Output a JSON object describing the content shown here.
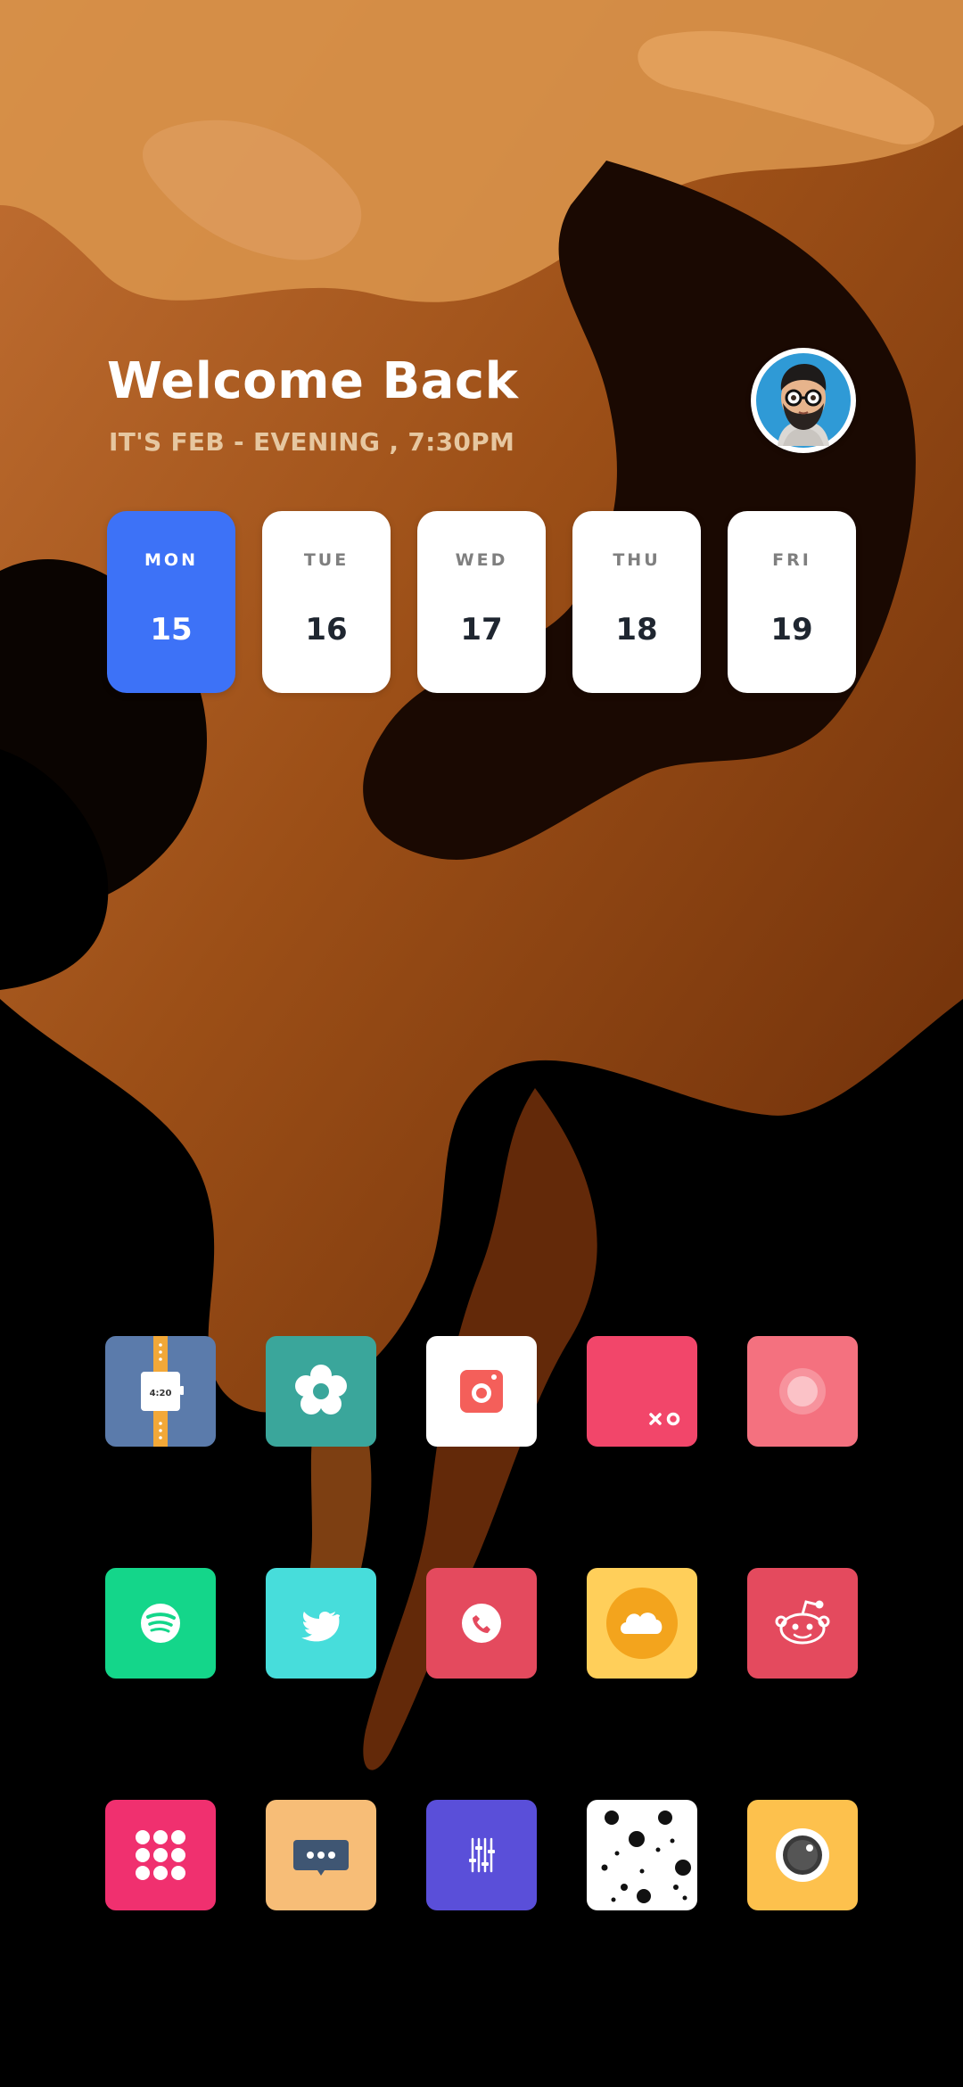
{
  "header": {
    "title": "Welcome Back",
    "subtitle": "IT'S FEB - EVENING , 7:30PM"
  },
  "avatar": {
    "icon": "memoji-avatar-icon"
  },
  "week": [
    {
      "day": "MON",
      "date": "15",
      "selected": true
    },
    {
      "day": "TUE",
      "date": "16",
      "selected": false
    },
    {
      "day": "WED",
      "date": "17",
      "selected": false
    },
    {
      "day": "THU",
      "date": "18",
      "selected": false
    },
    {
      "day": "FRI",
      "date": "19",
      "selected": false
    }
  ],
  "colors": {
    "active_day": "#3d72f7",
    "subtitle": "#e6c7a0",
    "wallpaper_tones": [
      "#d98f45",
      "#a85a1c",
      "#5c2608",
      "#000000"
    ]
  },
  "apps": [
    {
      "icon": "watch-app-icon",
      "color": "#5b7bab",
      "label": "4:20"
    },
    {
      "icon": "flower-app-icon",
      "color": "#3aa69b"
    },
    {
      "icon": "camera-app-icon",
      "color": "#ffffff"
    },
    {
      "icon": "tic-tac-toe-app-icon",
      "color": "#f2466a"
    },
    {
      "icon": "record-app-icon",
      "color": "#f4717f"
    },
    {
      "icon": "spotify-app-icon",
      "color": "#14d68a"
    },
    {
      "icon": "twitter-app-icon",
      "color": "#47dddb"
    },
    {
      "icon": "phone-app-icon",
      "color": "#e44a5e"
    },
    {
      "icon": "weather-app-icon",
      "color": "#ffcf5a"
    },
    {
      "icon": "reddit-app-icon",
      "color": "#e44a5e"
    },
    {
      "icon": "dialpad-app-icon",
      "color": "#f0306f"
    },
    {
      "icon": "messages-app-icon",
      "color": "#f7bd77"
    },
    {
      "icon": "equalizer-app-icon",
      "color": "#5a4fd9"
    },
    {
      "icon": "dots-app-icon",
      "color": "#ffffff"
    },
    {
      "icon": "camera-lens-app-icon",
      "color": "#fdc14d"
    }
  ]
}
